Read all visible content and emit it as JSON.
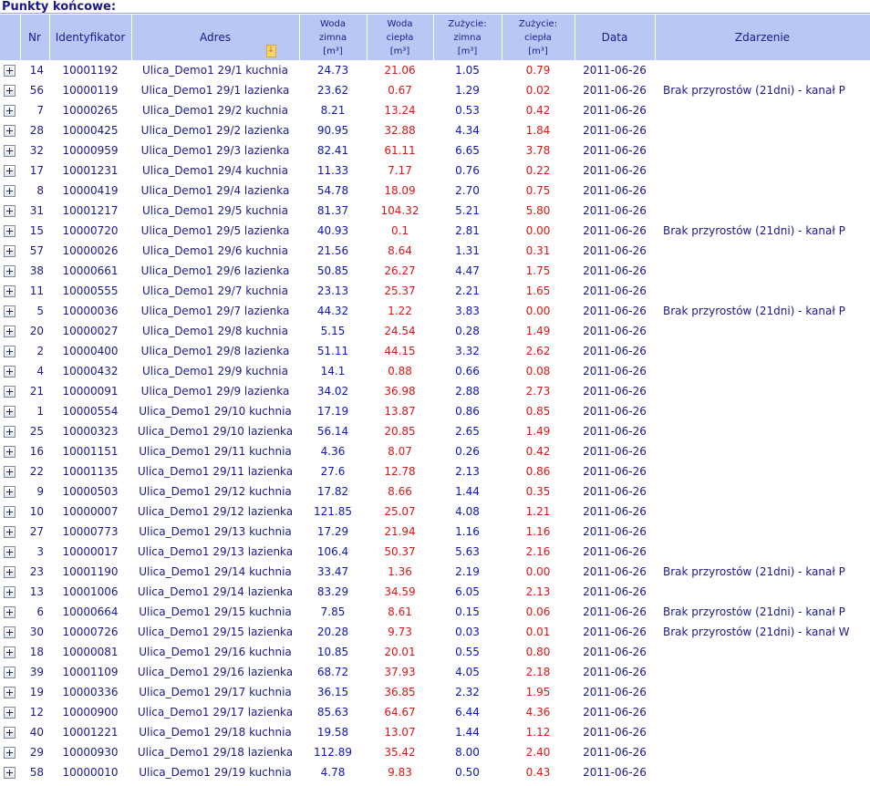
{
  "page": {
    "section_title": "Punkty końcowe:"
  },
  "table": {
    "headers": {
      "nr": "Nr",
      "identifier": "Identyfikator",
      "address": "Adres",
      "cold_water_l1": "Woda",
      "cold_water_l2": "zimna",
      "cold_water_unit": "[m³]",
      "hot_water_l1": "Woda",
      "hot_water_l2": "ciepła",
      "hot_water_unit": "[m³]",
      "use_cold_l1": "Zużycie:",
      "use_cold_l2": "zimna",
      "use_cold_unit": "[m³]",
      "use_hot_l1": "Zużycie:",
      "use_hot_l2": "ciepła",
      "use_hot_unit": "[m³]",
      "date": "Data",
      "event": "Zdarzenie"
    },
    "rows": [
      {
        "nr": "14",
        "id": "10001192",
        "addr": "Ulica_Demo1 29/1 kuchnia",
        "cold": "24.73",
        "hot": "21.06",
        "use_cold": "1.05",
        "use_hot": "0.79",
        "date": "2011-06-26",
        "event": ""
      },
      {
        "nr": "56",
        "id": "10000119",
        "addr": "Ulica_Demo1 29/1 lazienka",
        "cold": "23.62",
        "hot": "0.67",
        "use_cold": "1.29",
        "use_hot": "0.02",
        "date": "2011-06-26",
        "event": "Brak przyrostów (21dni) - kanał P"
      },
      {
        "nr": "7",
        "id": "10000265",
        "addr": "Ulica_Demo1 29/2 kuchnia",
        "cold": "8.21",
        "hot": "13.24",
        "use_cold": "0.53",
        "use_hot": "0.42",
        "date": "2011-06-26",
        "event": ""
      },
      {
        "nr": "28",
        "id": "10000425",
        "addr": "Ulica_Demo1 29/2 lazienka",
        "cold": "90.95",
        "hot": "32.88",
        "use_cold": "4.34",
        "use_hot": "1.84",
        "date": "2011-06-26",
        "event": ""
      },
      {
        "nr": "32",
        "id": "10000959",
        "addr": "Ulica_Demo1 29/3 lazienka",
        "cold": "82.41",
        "hot": "61.11",
        "use_cold": "6.65",
        "use_hot": "3.78",
        "date": "2011-06-26",
        "event": ""
      },
      {
        "nr": "17",
        "id": "10001231",
        "addr": "Ulica_Demo1 29/4 kuchnia",
        "cold": "11.33",
        "hot": "7.17",
        "use_cold": "0.76",
        "use_hot": "0.22",
        "date": "2011-06-26",
        "event": ""
      },
      {
        "nr": "8",
        "id": "10000419",
        "addr": "Ulica_Demo1 29/4 lazienka",
        "cold": "54.78",
        "hot": "18.09",
        "use_cold": "2.70",
        "use_hot": "0.75",
        "date": "2011-06-26",
        "event": ""
      },
      {
        "nr": "31",
        "id": "10001217",
        "addr": "Ulica_Demo1 29/5 kuchnia",
        "cold": "81.37",
        "hot": "104.32",
        "use_cold": "5.21",
        "use_hot": "5.80",
        "date": "2011-06-26",
        "event": ""
      },
      {
        "nr": "15",
        "id": "10000720",
        "addr": "Ulica_Demo1 29/5 lazienka",
        "cold": "40.93",
        "hot": "0.1",
        "use_cold": "2.81",
        "use_hot": "0.00",
        "date": "2011-06-26",
        "event": "Brak przyrostów (21dni) - kanał P"
      },
      {
        "nr": "57",
        "id": "10000026",
        "addr": "Ulica_Demo1 29/6 kuchnia",
        "cold": "21.56",
        "hot": "8.64",
        "use_cold": "1.31",
        "use_hot": "0.31",
        "date": "2011-06-26",
        "event": ""
      },
      {
        "nr": "38",
        "id": "10000661",
        "addr": "Ulica_Demo1 29/6 lazienka",
        "cold": "50.85",
        "hot": "26.27",
        "use_cold": "4.47",
        "use_hot": "1.75",
        "date": "2011-06-26",
        "event": ""
      },
      {
        "nr": "11",
        "id": "10000555",
        "addr": "Ulica_Demo1 29/7 kuchnia",
        "cold": "23.13",
        "hot": "25.37",
        "use_cold": "2.21",
        "use_hot": "1.65",
        "date": "2011-06-26",
        "event": ""
      },
      {
        "nr": "5",
        "id": "10000036",
        "addr": "Ulica_Demo1 29/7 lazienka",
        "cold": "44.32",
        "hot": "1.22",
        "use_cold": "3.83",
        "use_hot": "0.00",
        "date": "2011-06-26",
        "event": "Brak przyrostów (21dni) - kanał P"
      },
      {
        "nr": "20",
        "id": "10000027",
        "addr": "Ulica_Demo1 29/8 kuchnia",
        "cold": "5.15",
        "hot": "24.54",
        "use_cold": "0.28",
        "use_hot": "1.49",
        "date": "2011-06-26",
        "event": ""
      },
      {
        "nr": "2",
        "id": "10000400",
        "addr": "Ulica_Demo1 29/8 lazienka",
        "cold": "51.11",
        "hot": "44.15",
        "use_cold": "3.32",
        "use_hot": "2.62",
        "date": "2011-06-26",
        "event": ""
      },
      {
        "nr": "4",
        "id": "10000432",
        "addr": "Ulica_Demo1 29/9 kuchnia",
        "cold": "14.1",
        "hot": "0.88",
        "use_cold": "0.66",
        "use_hot": "0.08",
        "date": "2011-06-26",
        "event": ""
      },
      {
        "nr": "21",
        "id": "10000091",
        "addr": "Ulica_Demo1 29/9 lazienka",
        "cold": "34.02",
        "hot": "36.98",
        "use_cold": "2.88",
        "use_hot": "2.73",
        "date": "2011-06-26",
        "event": ""
      },
      {
        "nr": "1",
        "id": "10000554",
        "addr": "Ulica_Demo1 29/10 kuchnia",
        "cold": "17.19",
        "hot": "13.87",
        "use_cold": "0.86",
        "use_hot": "0.85",
        "date": "2011-06-26",
        "event": ""
      },
      {
        "nr": "25",
        "id": "10000323",
        "addr": "Ulica_Demo1 29/10 lazienka",
        "cold": "56.14",
        "hot": "20.85",
        "use_cold": "2.65",
        "use_hot": "1.49",
        "date": "2011-06-26",
        "event": ""
      },
      {
        "nr": "16",
        "id": "10001151",
        "addr": "Ulica_Demo1 29/11 kuchnia",
        "cold": "4.36",
        "hot": "8.07",
        "use_cold": "0.26",
        "use_hot": "0.42",
        "date": "2011-06-26",
        "event": ""
      },
      {
        "nr": "22",
        "id": "10001135",
        "addr": "Ulica_Demo1 29/11 lazienka",
        "cold": "27.6",
        "hot": "12.78",
        "use_cold": "2.13",
        "use_hot": "0.86",
        "date": "2011-06-26",
        "event": ""
      },
      {
        "nr": "9",
        "id": "10000503",
        "addr": "Ulica_Demo1 29/12 kuchnia",
        "cold": "17.82",
        "hot": "8.66",
        "use_cold": "1.44",
        "use_hot": "0.35",
        "date": "2011-06-26",
        "event": ""
      },
      {
        "nr": "10",
        "id": "10000007",
        "addr": "Ulica_Demo1 29/12 lazienka",
        "cold": "121.85",
        "hot": "25.07",
        "use_cold": "4.08",
        "use_hot": "1.21",
        "date": "2011-06-26",
        "event": ""
      },
      {
        "nr": "27",
        "id": "10000773",
        "addr": "Ulica_Demo1 29/13 kuchnia",
        "cold": "17.29",
        "hot": "21.94",
        "use_cold": "1.16",
        "use_hot": "1.16",
        "date": "2011-06-26",
        "event": ""
      },
      {
        "nr": "3",
        "id": "10000017",
        "addr": "Ulica_Demo1 29/13 lazienka",
        "cold": "106.4",
        "hot": "50.37",
        "use_cold": "5.63",
        "use_hot": "2.16",
        "date": "2011-06-26",
        "event": ""
      },
      {
        "nr": "23",
        "id": "10001190",
        "addr": "Ulica_Demo1 29/14 kuchnia",
        "cold": "33.47",
        "hot": "1.36",
        "use_cold": "2.19",
        "use_hot": "0.00",
        "date": "2011-06-26",
        "event": "Brak przyrostów (21dni) - kanał P"
      },
      {
        "nr": "13",
        "id": "10001006",
        "addr": "Ulica_Demo1 29/14 lazienka",
        "cold": "83.29",
        "hot": "34.59",
        "use_cold": "6.05",
        "use_hot": "2.13",
        "date": "2011-06-26",
        "event": ""
      },
      {
        "nr": "6",
        "id": "10000664",
        "addr": "Ulica_Demo1 29/15 kuchnia",
        "cold": "7.85",
        "hot": "8.61",
        "use_cold": "0.15",
        "use_hot": "0.06",
        "date": "2011-06-26",
        "event": "Brak przyrostów (21dni) - kanał P"
      },
      {
        "nr": "30",
        "id": "10000726",
        "addr": "Ulica_Demo1 29/15 lazienka",
        "cold": "20.28",
        "hot": "9.73",
        "use_cold": "0.03",
        "use_hot": "0.01",
        "date": "2011-06-26",
        "event": "Brak przyrostów (21dni) - kanał W"
      },
      {
        "nr": "18",
        "id": "10000081",
        "addr": "Ulica_Demo1 29/16 kuchnia",
        "cold": "10.85",
        "hot": "20.01",
        "use_cold": "0.55",
        "use_hot": "0.80",
        "date": "2011-06-26",
        "event": ""
      },
      {
        "nr": "39",
        "id": "10001109",
        "addr": "Ulica_Demo1 29/16 lazienka",
        "cold": "68.72",
        "hot": "37.93",
        "use_cold": "4.05",
        "use_hot": "2.18",
        "date": "2011-06-26",
        "event": ""
      },
      {
        "nr": "19",
        "id": "10000336",
        "addr": "Ulica_Demo1 29/17 kuchnia",
        "cold": "36.15",
        "hot": "36.85",
        "use_cold": "2.32",
        "use_hot": "1.95",
        "date": "2011-06-26",
        "event": ""
      },
      {
        "nr": "12",
        "id": "10000900",
        "addr": "Ulica_Demo1 29/17 lazienka",
        "cold": "85.63",
        "hot": "64.67",
        "use_cold": "6.44",
        "use_hot": "4.36",
        "date": "2011-06-26",
        "event": ""
      },
      {
        "nr": "40",
        "id": "10001221",
        "addr": "Ulica_Demo1 29/18 kuchnia",
        "cold": "19.58",
        "hot": "13.07",
        "use_cold": "1.44",
        "use_hot": "1.12",
        "date": "2011-06-26",
        "event": ""
      },
      {
        "nr": "29",
        "id": "10000930",
        "addr": "Ulica_Demo1 29/18 lazienka",
        "cold": "112.89",
        "hot": "35.42",
        "use_cold": "8.00",
        "use_hot": "2.40",
        "date": "2011-06-26",
        "event": ""
      },
      {
        "nr": "58",
        "id": "10000010",
        "addr": "Ulica_Demo1 29/19 kuchnia",
        "cold": "4.78",
        "hot": "9.83",
        "use_cold": "0.50",
        "use_hot": "0.43",
        "date": "2011-06-26",
        "event": ""
      }
    ]
  },
  "icons": {
    "expand": "plus-expand-icon",
    "sort": "sort-arrow-icon"
  },
  "colors": {
    "header_bg": "#b9c7f4",
    "text_blue": "#0b16b8",
    "text_red": "#e01414",
    "title_navy": "#1a1a8c"
  }
}
